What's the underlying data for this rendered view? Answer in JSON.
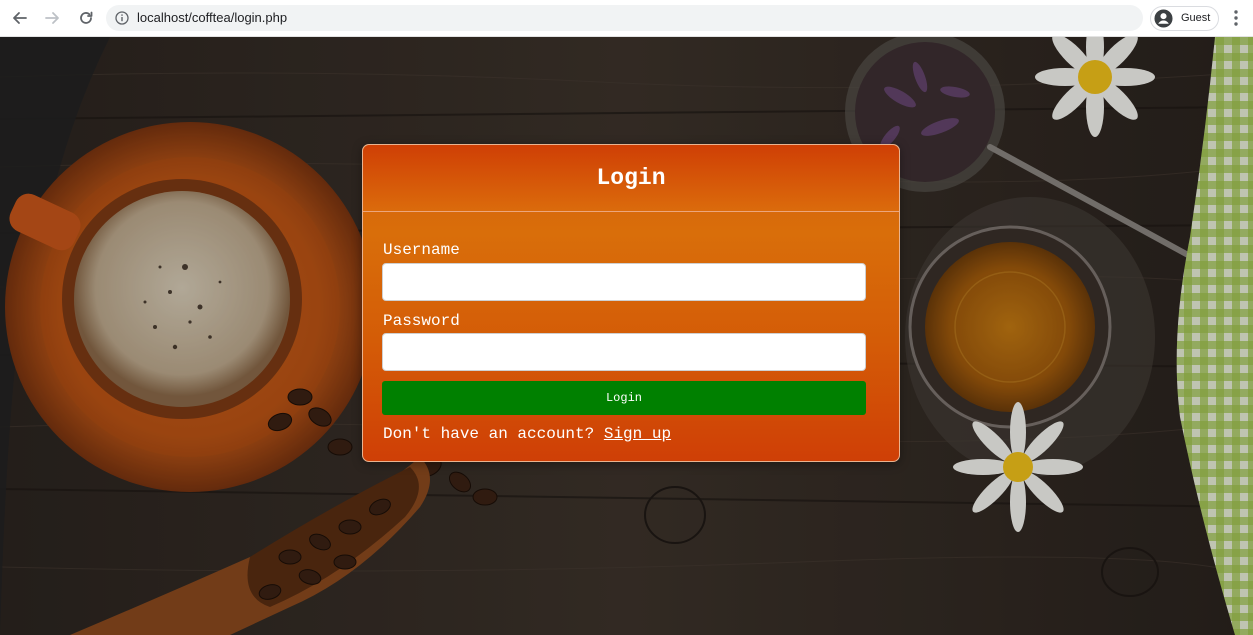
{
  "browser": {
    "url": "localhost/cofftea/login.php",
    "profile_label": "Guest"
  },
  "login": {
    "title": "Login",
    "username_label": "Username",
    "username_value": "",
    "password_label": "Password",
    "password_value": "",
    "button_label": "Login",
    "signup_prompt": "Don't have an account?",
    "signup_link": "Sign up"
  },
  "colors": {
    "card_orange": "#d65d0e",
    "login_button": "#008000"
  }
}
